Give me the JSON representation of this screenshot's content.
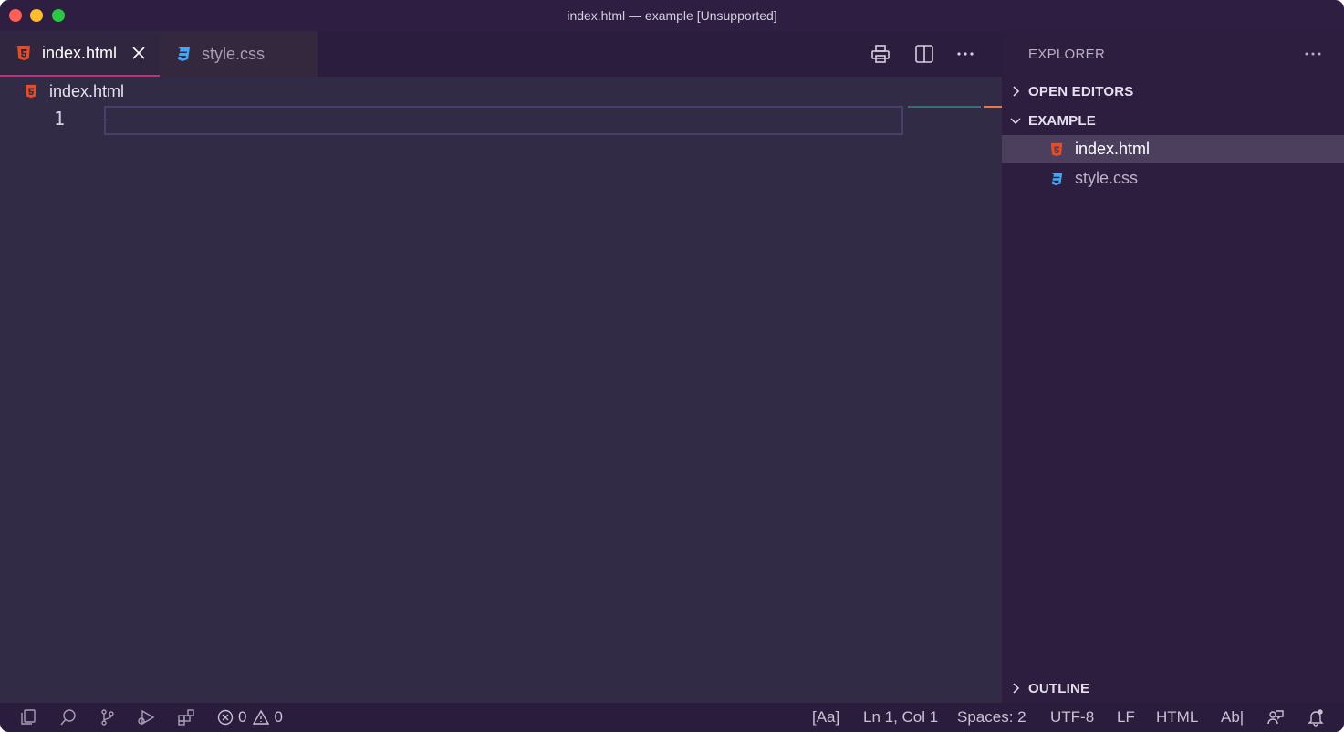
{
  "window": {
    "title": "index.html — example [Unsupported]"
  },
  "tabs": [
    {
      "label": "index.html",
      "icon": "html5-icon",
      "active": true
    },
    {
      "label": "style.css",
      "icon": "css3-icon",
      "active": false
    }
  ],
  "editor_actions": [
    "print-icon",
    "split-editor-icon",
    "more-actions-icon"
  ],
  "breadcrumb": {
    "file": "index.html"
  },
  "editor": {
    "line_numbers": [
      "1"
    ]
  },
  "sidebar": {
    "title": "EXPLORER",
    "sections": {
      "open_editors": "OPEN EDITORS",
      "folder": "EXAMPLE",
      "outline": "OUTLINE"
    },
    "files": [
      {
        "label": "index.html",
        "icon": "html5-icon",
        "selected": true
      },
      {
        "label": "style.css",
        "icon": "css3-icon",
        "selected": false
      }
    ]
  },
  "statusbar": {
    "errors": "0",
    "warnings": "0",
    "case": "[Aa]",
    "position": "Ln 1, Col 1",
    "spaces": "Spaces: 2",
    "encoding": "UTF-8",
    "eol": "LF",
    "language": "HTML",
    "spell": "Ab|"
  },
  "colors": {
    "html_icon": "#e44d26",
    "css_icon": "#42a5f5",
    "active_tab_border": "#b3347f",
    "selection": "#4c3f5e"
  }
}
